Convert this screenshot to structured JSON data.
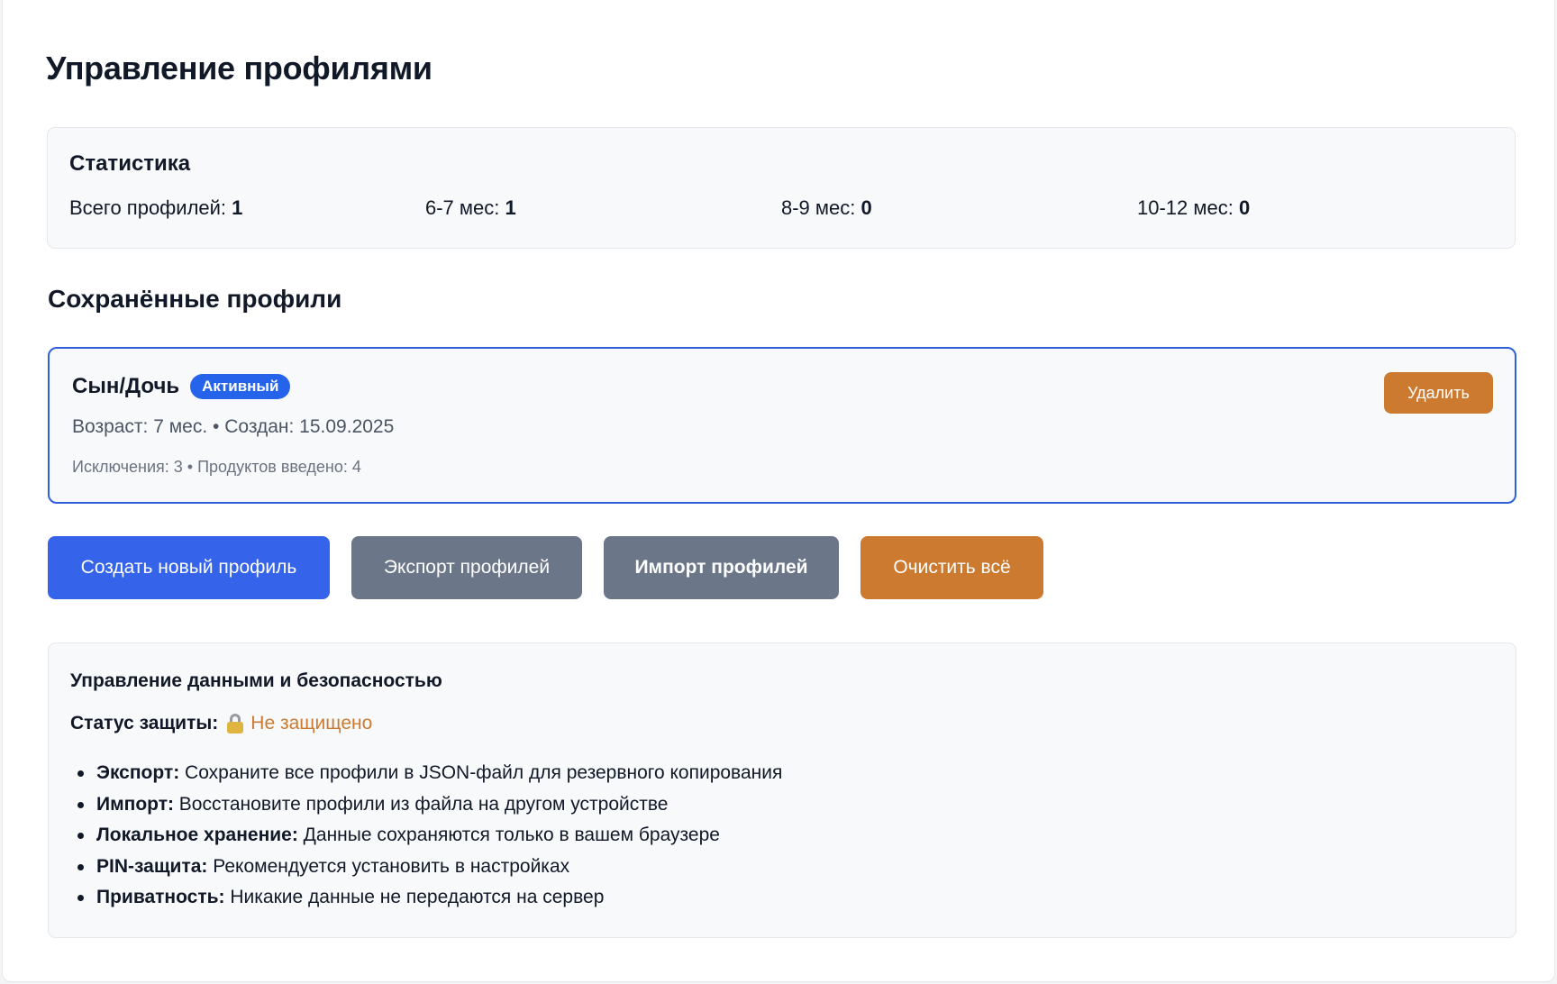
{
  "page": {
    "title": "Управление профилями"
  },
  "stats": {
    "title": "Статистика",
    "items": [
      {
        "label": "Всего профилей:",
        "value": "1"
      },
      {
        "label": "6-7 мес:",
        "value": "1"
      },
      {
        "label": "8-9 мес:",
        "value": "0"
      },
      {
        "label": "10-12 мес:",
        "value": "0"
      }
    ]
  },
  "saved": {
    "title": "Сохранённые профили",
    "profiles": [
      {
        "name": "Сын/Дочь",
        "badge": "Активный",
        "meta": "Возраст: 7 мес. • Создан: 15.09.2025",
        "sub": "Исключения: 3 • Продуктов введено: 4",
        "delete_label": "Удалить"
      }
    ]
  },
  "actions": {
    "create_label": "Создать новый профиль",
    "export_label": "Экспорт профилей",
    "import_label": "Импорт профилей",
    "clear_label": "Очистить всё"
  },
  "security": {
    "title": "Управление данными и безопасностью",
    "status_label": "Статус защиты:",
    "status_icon": "lock-icon",
    "status_value": "Не защищено",
    "features": [
      {
        "term": "Экспорт:",
        "text": " Сохраните все профили в JSON-файл для резервного копирования"
      },
      {
        "term": "Импорт:",
        "text": " Восстановите профили из файла на другом устройстве"
      },
      {
        "term": "Локальное хранение:",
        "text": " Данные сохраняются только в вашем браузере"
      },
      {
        "term": "PIN-защита:",
        "text": " Рекомендуется установить в настройках"
      },
      {
        "term": "Приватность:",
        "text": " Никакие данные не передаются на сервер"
      }
    ]
  },
  "colors": {
    "primary": "#3563e9",
    "gray": "#6b7689",
    "orange": "#cd7a31",
    "active_border": "#2f5fd9"
  }
}
